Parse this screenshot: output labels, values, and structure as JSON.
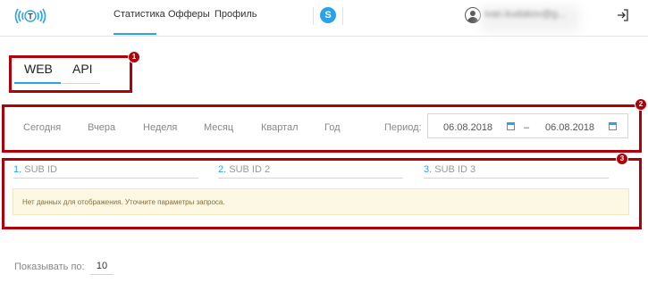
{
  "header": {
    "nav": [
      {
        "label": "Статистика",
        "active": true
      },
      {
        "label": "Офферы",
        "active": false
      },
      {
        "label": "Профиль",
        "active": false
      }
    ],
    "skype_label": "S",
    "user_email": "ivan.kudakov@g...",
    "accent_color": "#29a3e8"
  },
  "annotations": [
    "1",
    "2",
    "3"
  ],
  "tabs": [
    {
      "label": "WEB",
      "active": true
    },
    {
      "label": "API",
      "active": false
    }
  ],
  "period": {
    "presets": [
      "Сегодня",
      "Вчера",
      "Неделя",
      "Месяц",
      "Квартал",
      "Год"
    ],
    "label": "Период:",
    "from": "06.08.2018",
    "separator": "–",
    "to": "06.08.2018"
  },
  "sub_ids": [
    {
      "num": "1.",
      "placeholder": "SUB ID"
    },
    {
      "num": "2.",
      "placeholder": "SUB ID 2"
    },
    {
      "num": "3.",
      "placeholder": "SUB ID 3"
    }
  ],
  "notice": "Нет данных для отображения. Уточните параметры запроса.",
  "pagination": {
    "label": "Показывать по:",
    "value": "10"
  }
}
